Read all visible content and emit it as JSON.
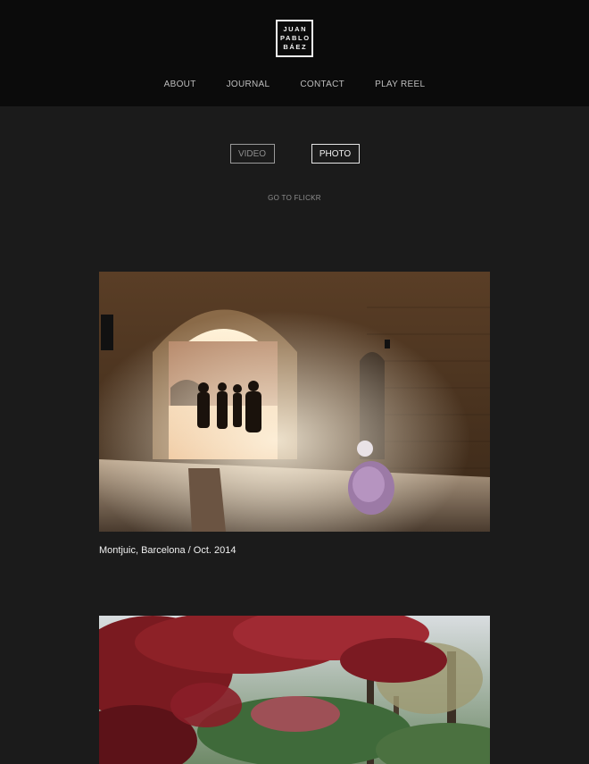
{
  "logo": {
    "lines": [
      "JUAN",
      "PABLO",
      "BÁEZ"
    ]
  },
  "nav": [
    "ABOUT",
    "JOURNAL",
    "CONTACT",
    "PLAY REEL"
  ],
  "toggles": {
    "video": "VIDEO",
    "photo": "PHOTO",
    "active": "photo"
  },
  "flickr_link": "GO TO FLICKR",
  "photos": [
    {
      "caption": "Montjuic, Barcelona / Oct. 2014"
    },
    {
      "caption": ""
    }
  ],
  "colors": {
    "header_bg": "#0b0b0b",
    "page_bg": "#1b1b1b",
    "accent": "#f2f2f2"
  }
}
